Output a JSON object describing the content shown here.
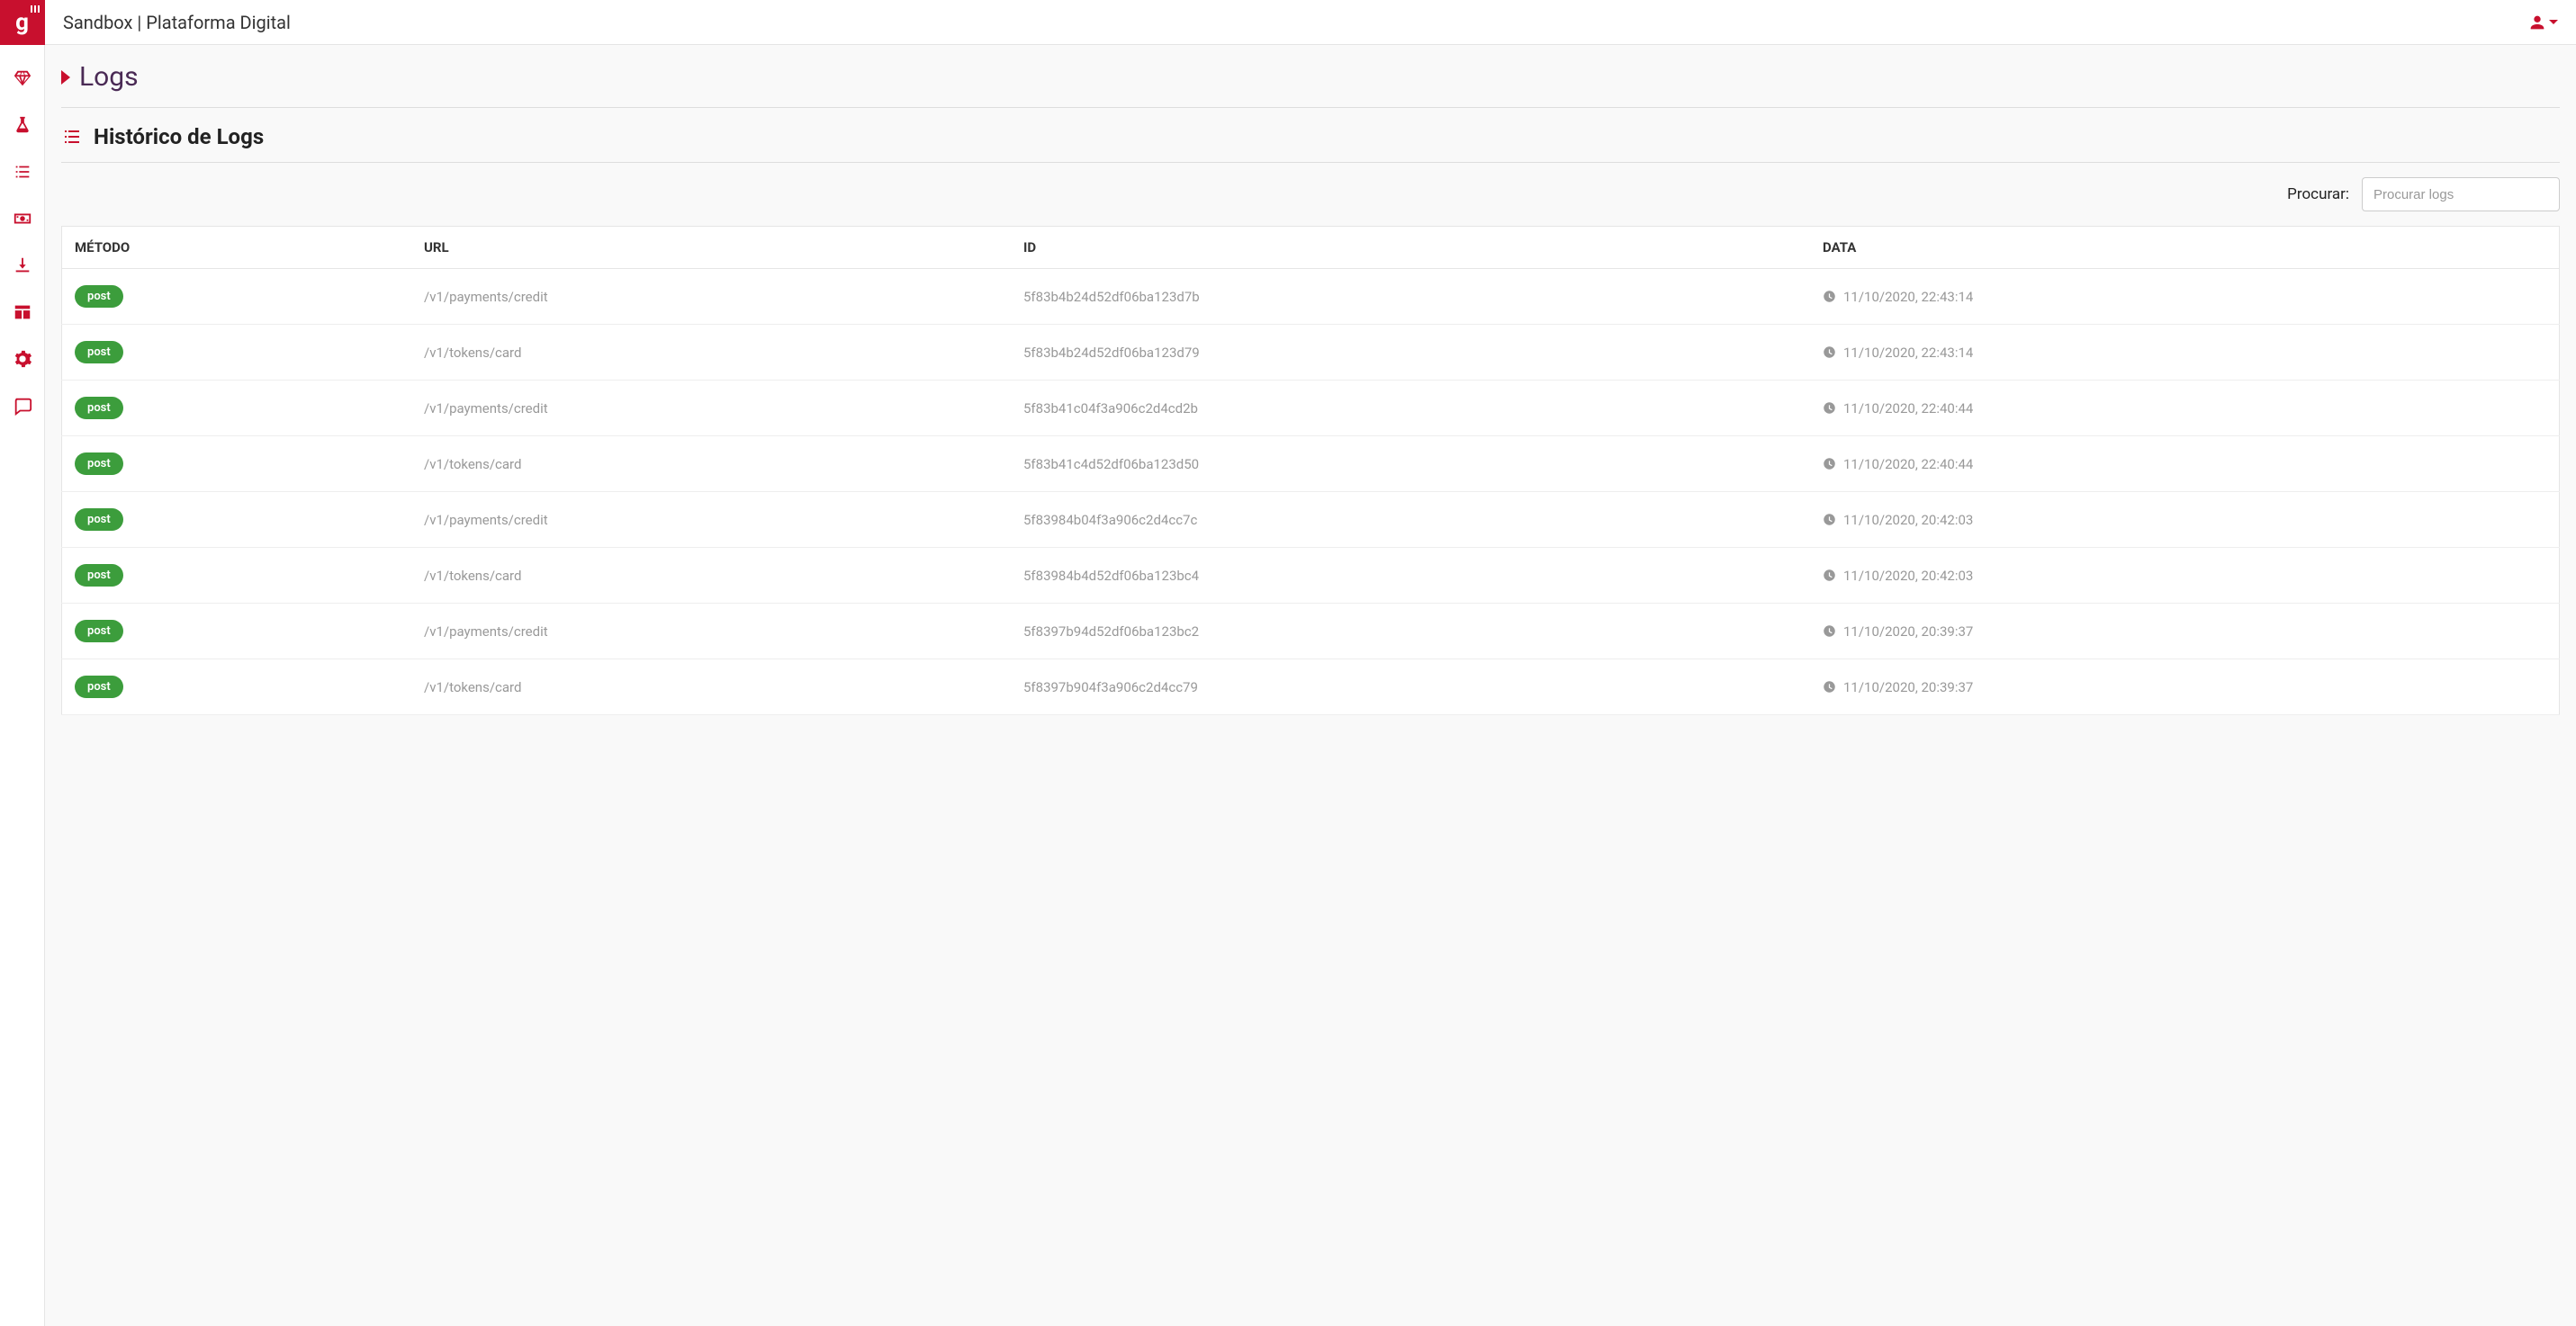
{
  "topbar": {
    "title": "Sandbox | Plataforma Digital"
  },
  "page": {
    "title": "Logs",
    "section_title": "Histórico de Logs"
  },
  "search": {
    "label": "Procurar:",
    "placeholder": "Procurar logs"
  },
  "table": {
    "headers": {
      "method": "MÉTODO",
      "url": "URL",
      "id": "ID",
      "date": "DATA"
    },
    "rows": [
      {
        "method": "post",
        "url": "/v1/payments/credit",
        "id": "5f83b4b24d52df06ba123d7b",
        "date": "11/10/2020, 22:43:14"
      },
      {
        "method": "post",
        "url": "/v1/tokens/card",
        "id": "5f83b4b24d52df06ba123d79",
        "date": "11/10/2020, 22:43:14"
      },
      {
        "method": "post",
        "url": "/v1/payments/credit",
        "id": "5f83b41c04f3a906c2d4cd2b",
        "date": "11/10/2020, 22:40:44"
      },
      {
        "method": "post",
        "url": "/v1/tokens/card",
        "id": "5f83b41c4d52df06ba123d50",
        "date": "11/10/2020, 22:40:44"
      },
      {
        "method": "post",
        "url": "/v1/payments/credit",
        "id": "5f83984b04f3a906c2d4cc7c",
        "date": "11/10/2020, 20:42:03"
      },
      {
        "method": "post",
        "url": "/v1/tokens/card",
        "id": "5f83984b4d52df06ba123bc4",
        "date": "11/10/2020, 20:42:03"
      },
      {
        "method": "post",
        "url": "/v1/payments/credit",
        "id": "5f8397b94d52df06ba123bc2",
        "date": "11/10/2020, 20:39:37"
      },
      {
        "method": "post",
        "url": "/v1/tokens/card",
        "id": "5f8397b904f3a906c2d4cc79",
        "date": "11/10/2020, 20:39:37"
      }
    ]
  },
  "sidebar": {
    "items": [
      {
        "name": "diamond"
      },
      {
        "name": "flask"
      },
      {
        "name": "list"
      },
      {
        "name": "money"
      },
      {
        "name": "download"
      },
      {
        "name": "grid"
      },
      {
        "name": "gear"
      },
      {
        "name": "comment"
      }
    ]
  }
}
